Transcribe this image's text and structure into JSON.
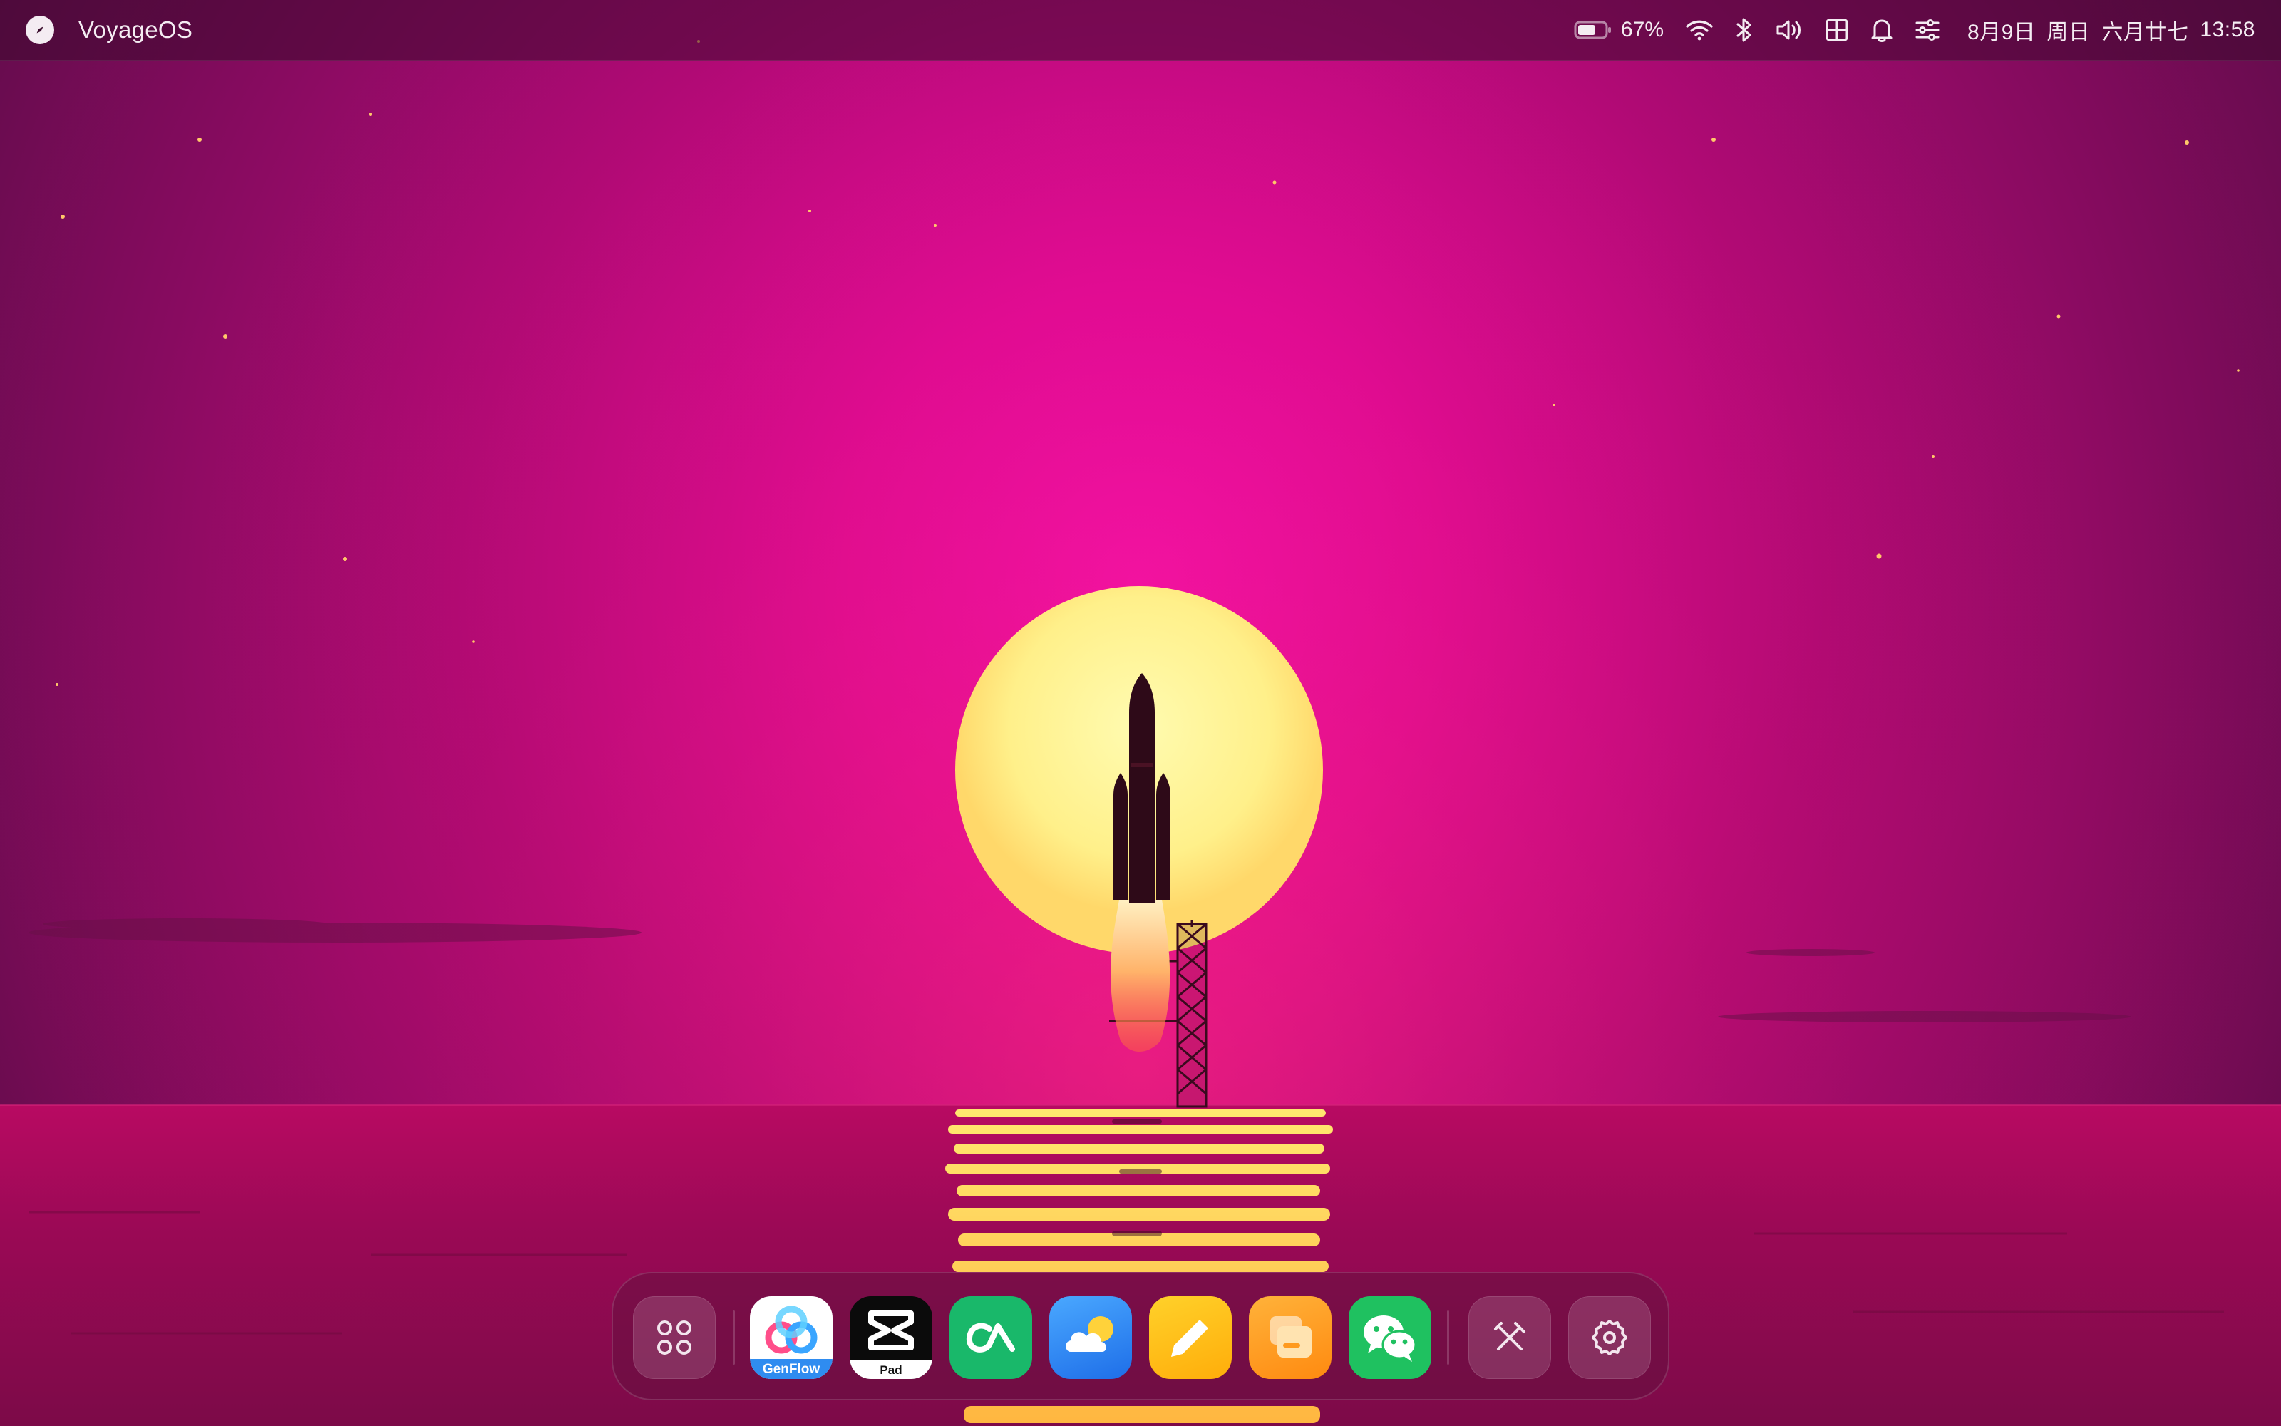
{
  "menubar": {
    "logo_icon": "compass-icon",
    "app_title": "VoyageOS",
    "battery_percent": "67%",
    "battery_level": 0.67,
    "tray_icons": [
      "battery-icon",
      "wifi-icon",
      "bluetooth-icon",
      "volume-icon",
      "layout-grid-icon",
      "bell-icon",
      "sliders-icon"
    ],
    "date": "8月9日",
    "weekday": "周日",
    "lunar_date": "六月廿七",
    "time": "13:58"
  },
  "dock": {
    "items": [
      {
        "name": "launcher",
        "icon": "app-grid-icon"
      },
      {
        "name": "GenFlow",
        "icon": "genflow-icon",
        "label": "GenFlow",
        "color": "#2f8cf0"
      },
      {
        "name": "CapCut Pad",
        "icon": "capcut-icon",
        "label": "Pad",
        "color": "#111111"
      },
      {
        "name": "Anything app",
        "icon": "green-wave-icon",
        "color": "#19b86a"
      },
      {
        "name": "Weather",
        "icon": "weather-icon",
        "color": "#2b86f5"
      },
      {
        "name": "Notes",
        "icon": "pencil-icon",
        "color": "#ffc21a"
      },
      {
        "name": "Files",
        "icon": "folder-icon",
        "color": "#ff9a1f"
      },
      {
        "name": "WeChat",
        "icon": "wechat-icon",
        "color": "#1fc160"
      },
      {
        "name": "Tools",
        "icon": "tools-icon"
      },
      {
        "name": "Settings",
        "icon": "gear-icon"
      }
    ]
  },
  "colors": {
    "sky_top": "#6e0e52",
    "sky_glow": "#ff12b4",
    "sun": "#ffee80",
    "sea": "#9a0a57"
  }
}
